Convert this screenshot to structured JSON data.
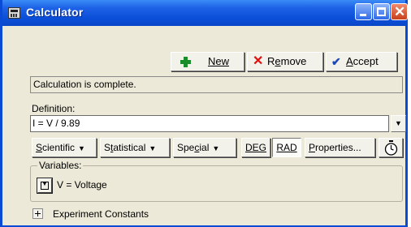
{
  "window": {
    "title": "Calculator",
    "colors": {
      "titlebar": "#0a4bd6",
      "close": "#c8401d",
      "face": "#ece9d8"
    }
  },
  "toolbar": {
    "new_label": "New",
    "remove_label_pre": "R",
    "remove_label_u": "e",
    "remove_label_post": "move",
    "accept_label_u": "A",
    "accept_label_post": "ccept"
  },
  "status": {
    "text": "Calculation is complete."
  },
  "definition": {
    "label": "Definition:",
    "value": "I = V / 9.89"
  },
  "function_bar": {
    "scientific_u": "S",
    "scientific_post": "cientific",
    "statistical_u": "t",
    "statistical_pre": "S",
    "statistical_post": "atistical",
    "special_pre": "Spe",
    "special_u": "c",
    "special_post": "ial",
    "deg_label": "DEG",
    "rad_label": "RAD",
    "properties_u": "P",
    "properties_post": "roperties..."
  },
  "variables": {
    "legend": "Variables:",
    "items": [
      {
        "label": "V = Voltage"
      }
    ]
  },
  "experiment": {
    "label": "Experiment Constants"
  },
  "icons": [
    "calculator-icon",
    "plus-icon",
    "x-icon",
    "check-icon",
    "stopwatch-icon",
    "chevron-down-icon"
  ]
}
